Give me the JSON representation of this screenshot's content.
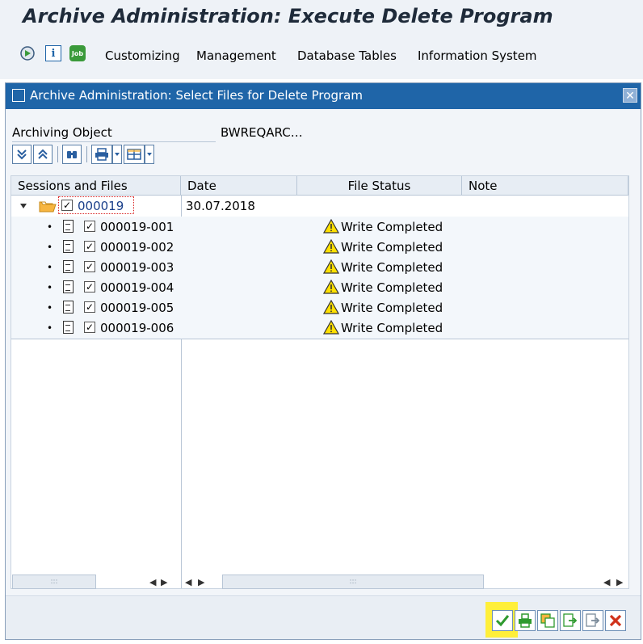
{
  "window": {
    "title": "Archive Administration: Execute Delete Program"
  },
  "toolbar": {
    "icons": [
      "execute-icon",
      "info-icon",
      "job-icon"
    ],
    "job_label": "Job",
    "info_label": "i",
    "menu": [
      "Customizing",
      "Management",
      "Database Tables",
      "Information System"
    ]
  },
  "dialog": {
    "title": "Archive Administration: Select Files for Delete Program",
    "close": "✕",
    "archiving_object_label": "Archiving Object",
    "archiving_object_value": "BWREQARC…",
    "columns": [
      "Sessions and Files",
      "Date",
      "File Status",
      "Note"
    ],
    "session": {
      "id": "000019",
      "date": "30.07.2018",
      "checked": true
    },
    "files": [
      {
        "name": "000019-001",
        "status": "Write Completed",
        "checked": true
      },
      {
        "name": "000019-002",
        "status": "Write Completed",
        "checked": true
      },
      {
        "name": "000019-003",
        "status": "Write Completed",
        "checked": true
      },
      {
        "name": "000019-004",
        "status": "Write Completed",
        "checked": true
      },
      {
        "name": "000019-005",
        "status": "Write Completed",
        "checked": true
      },
      {
        "name": "000019-006",
        "status": "Write Completed",
        "checked": true
      }
    ],
    "scroll_grip": ":::",
    "footer_buttons": [
      "continue-check-icon",
      "print-icon",
      "copy-icon",
      "export-icon",
      "import-icon",
      "cancel-icon"
    ]
  },
  "colors": {
    "accent": "#1f65a8",
    "highlight": "#ffef3a",
    "warning": "#ffe000",
    "folder": "#f7b540",
    "ok": "#2e9a2e",
    "cancel": "#d0311a"
  }
}
